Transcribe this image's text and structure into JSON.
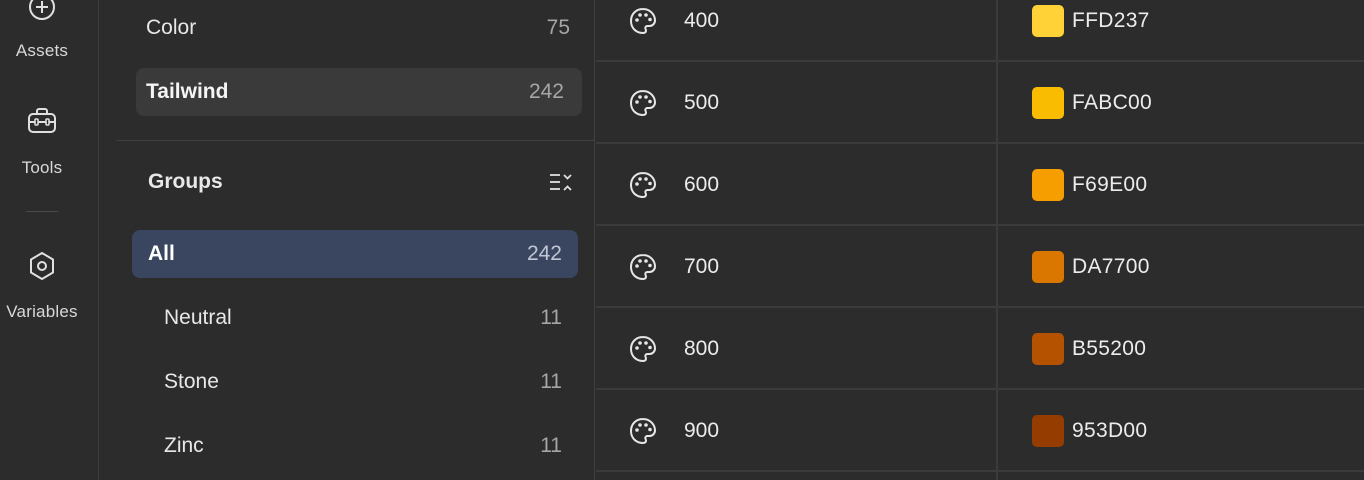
{
  "rail": {
    "items": [
      {
        "label": "Assets",
        "icon": "plus-circle-icon"
      },
      {
        "label": "Tools",
        "icon": "toolbox-icon"
      },
      {
        "label": "Variables",
        "icon": "hexagon-icon"
      }
    ]
  },
  "libraries": [
    {
      "name": "Color",
      "count": "75"
    },
    {
      "name": "Tailwind",
      "count": "242"
    }
  ],
  "groups": {
    "title": "Groups",
    "items": [
      {
        "name": "All",
        "count": "242"
      },
      {
        "name": "Neutral",
        "count": "11"
      },
      {
        "name": "Stone",
        "count": "11"
      },
      {
        "name": "Zinc",
        "count": "11"
      }
    ]
  },
  "variables": [
    {
      "name": "400",
      "hex": "FFD237",
      "color": "#FFD237"
    },
    {
      "name": "500",
      "hex": "FABC00",
      "color": "#FABC00"
    },
    {
      "name": "600",
      "hex": "F69E00",
      "color": "#F69E00"
    },
    {
      "name": "700",
      "hex": "DA7700",
      "color": "#DA7700"
    },
    {
      "name": "800",
      "hex": "B55200",
      "color": "#B55200"
    },
    {
      "name": "900",
      "hex": "953D00",
      "color": "#953D00"
    }
  ]
}
